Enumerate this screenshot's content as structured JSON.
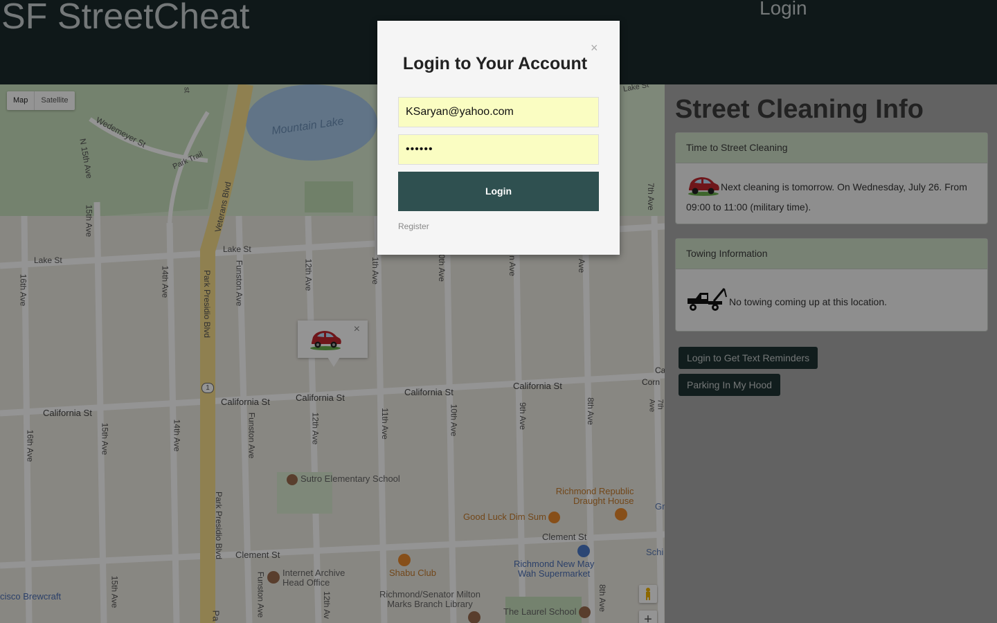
{
  "header": {
    "brand": "SF StreetCheat",
    "login_link": "Login"
  },
  "map": {
    "type_buttons": [
      "Map",
      "Satellite"
    ],
    "labels": {
      "lake": "Mountain Lake",
      "wedemeyer": "Wedemeyer St",
      "park_trail": "Park Trail",
      "n15": "N 15th Ave",
      "veterans": "Veterans Blvd",
      "lake_st_1": "Lake St",
      "lake_st_2": "Lake St",
      "ave15": "15th Ave",
      "ave16": "16th Ave",
      "ave14": "14th Ave",
      "park_presidio_1": "Park Presidio Blvd",
      "park_presidio_2": "Park Presidio Blvd",
      "funston_1": "Funston Ave",
      "ave12": "12th Ave",
      "ave11": "11th Ave",
      "ave10": "10th Ave",
      "ave9": "9th Ave",
      "ave8": "8th Ave",
      "cal1": "California St",
      "cal2": "California St",
      "cal3": "California St",
      "cal4": "California St",
      "cal5": "California St",
      "ave16b": "16th Ave",
      "ave15b": "15th Ave",
      "ave14b": "14th Ave",
      "funston_2": "Funston Ave",
      "ave12b": "12th Ave",
      "ave11b": "11th Ave",
      "ave10b": "10th Ave",
      "ave9b": "9th Ave",
      "ave8b": "8th Ave",
      "ave7": "7th Ave",
      "sutro": "Sutro Elementary School",
      "richmond_republic": "Richmond Republic",
      "draught_house": "Draught House",
      "good_luck": "Good Luck Dim Sum",
      "clement_1": "Clement St",
      "clement_2": "Clement St",
      "shabu": "Shabu Club",
      "internet_archive": "Internet Archive",
      "head_office": "Head Office",
      "richmond_new": "Richmond New May",
      "wah": "Wah Supermarket",
      "library1": "Richmond/Senator Milton",
      "library2": "Marks Branch Library",
      "laurel": "The Laurel School",
      "brewcraft": "cisco Brewcraft",
      "ave15c": "15th Ave",
      "funston_3": "Funston Ave",
      "ave12c": "12th Av",
      "ave8c": "8th Ave",
      "ave7b": "7th Ave",
      "lake_st_top": "Lake St",
      "ca_partial": "Ca",
      "corn_partial": "Corn",
      "gr_partial": "Gr",
      "sch_partial": "Schi",
      "st_top": "st",
      "route1": "1",
      "pa_partial": "Pa",
      "ave_partial1": "n Ave",
      "ave_partial2": "Ave",
      "ave_partial3": "0th Ave",
      "ave_partial4": "1th Ave"
    }
  },
  "panel": {
    "title": "Street Cleaning Info",
    "cleaning": {
      "header": "Time to Street Cleaning",
      "text": "Next cleaning is tomorrow. On Wednesday, July 26. From 09:00 to 11:00 (military time)."
    },
    "towing": {
      "header": "Towing Information",
      "text": "No towing coming up at this location."
    },
    "buttons": {
      "reminders": "Login to Get Text Reminders",
      "hood": "Parking In My Hood"
    }
  },
  "modal": {
    "title": "Login to Your Account",
    "close": "×",
    "email_value": "KSaryan@yahoo.com",
    "password_value": "••••••",
    "login_button": "Login",
    "register_link": "Register"
  },
  "popup": {
    "close": "×"
  },
  "colors": {
    "header_bg": "#1b2a2c",
    "button_dark": "#2f5050",
    "card_header": "#cfe0c8"
  }
}
